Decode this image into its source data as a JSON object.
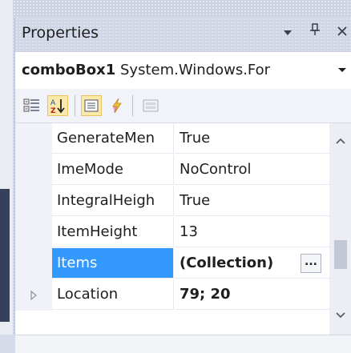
{
  "panel": {
    "title": "Properties",
    "buttons": {
      "dropdown_icon": "triangle-down-icon",
      "pin_icon": "pin-icon",
      "close_icon": "close-icon"
    }
  },
  "selector": {
    "object_name": "comboBox1",
    "object_type": "System.Windows.For"
  },
  "toolbar": {
    "tools": [
      "categorized-icon",
      "alphabetical-icon",
      "properties-icon",
      "events-icon",
      "property-pages-icon"
    ]
  },
  "grid": {
    "rows": [
      {
        "name": "GenerateMen",
        "value": "True",
        "bold": false,
        "selected": false,
        "expandable": false
      },
      {
        "name": "ImeMode",
        "value": "NoControl",
        "bold": false,
        "selected": false,
        "expandable": false
      },
      {
        "name": "IntegralHeigh",
        "value": "True",
        "bold": false,
        "selected": false,
        "expandable": false
      },
      {
        "name": "ItemHeight",
        "value": "13",
        "bold": false,
        "selected": false,
        "expandable": false
      },
      {
        "name": "Items",
        "value": "(Collection)",
        "bold": true,
        "selected": true,
        "expandable": false,
        "button": "..."
      },
      {
        "name": "Location",
        "value": "79; 20",
        "bold": true,
        "selected": false,
        "expandable": true
      }
    ]
  },
  "colors": {
    "selection": "#3399ff",
    "active_tool": "#fbe9a9"
  }
}
